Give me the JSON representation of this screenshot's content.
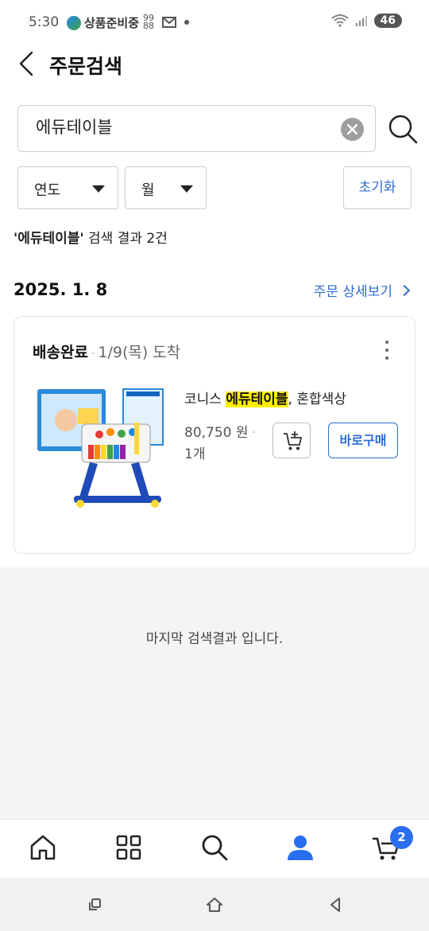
{
  "statusbar": {
    "time": "5:30",
    "app_name": "상품준비중",
    "battery": "46"
  },
  "header": {
    "title": "주문검색"
  },
  "search": {
    "query": "에듀테이블",
    "placeholder": ""
  },
  "filters": {
    "year_label": "연도",
    "month_label": "월",
    "reset_label": "초기화"
  },
  "result": {
    "keyword": "'에듀테이블'",
    "summary": " 검색 결과 2건"
  },
  "order": {
    "date": "2025. 1. 8",
    "detail_link": "주문 상세보기",
    "status": "배송완료",
    "arrival": "1/9(목) 도착",
    "product": {
      "brand": "코니스 ",
      "highlight": "에듀테이블",
      "suffix": ", 혼합색상",
      "price": "80,750 원",
      "quantity": "1개"
    },
    "buy_now_label": "바로구매"
  },
  "end_message": "마지막 검색결과 입니다.",
  "bottom_nav": {
    "items": [
      "home",
      "category",
      "search",
      "my",
      "cart"
    ],
    "cart_badge": "2",
    "active_color": "#2a6ef0"
  },
  "colors": {
    "accent": "#2c6dd1",
    "highlight": "#ffef00"
  }
}
